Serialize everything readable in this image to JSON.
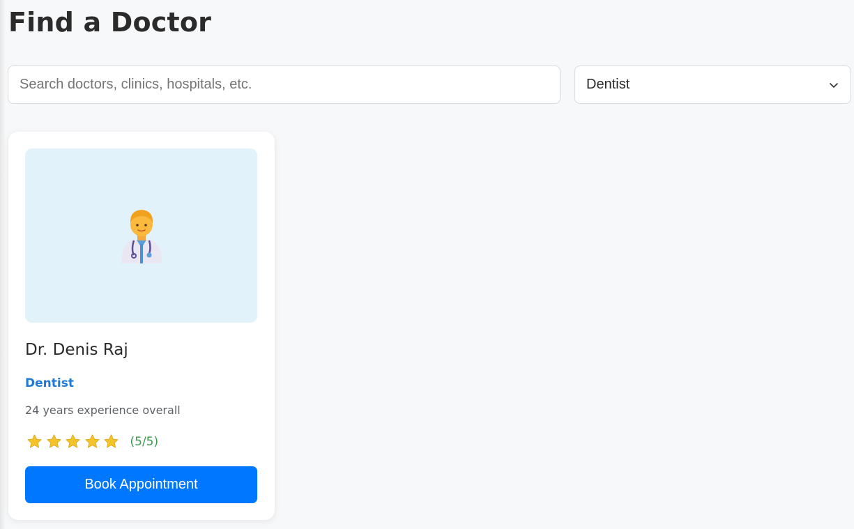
{
  "page": {
    "title": "Find a Doctor"
  },
  "search": {
    "placeholder": "Search doctors, clinics, hospitals, etc.",
    "value": ""
  },
  "filter": {
    "selected": "Dentist",
    "icon": "chevron-down-icon"
  },
  "doctors": [
    {
      "name": "Dr. Denis Raj",
      "specialty": "Dentist",
      "experience": "24 years experience overall",
      "rating": 5,
      "rating_max": 5,
      "rating_text": "(5/5)",
      "icon": "doctor-icon",
      "book_label": "Book Appointment"
    }
  ],
  "colors": {
    "accent": "#0077ff",
    "specialty": "#1e7ad6",
    "rating_text": "#3a9a49",
    "star": "#f3c32c",
    "photo_bg": "#e1f2fa",
    "page_bg": "#f7f8fa"
  }
}
